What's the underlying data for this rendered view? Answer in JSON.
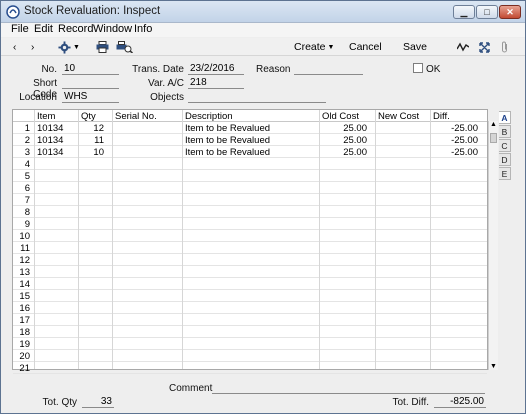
{
  "window": {
    "title": "Stock Revaluation: Inspect"
  },
  "menu": [
    "File",
    "Edit",
    "Record",
    "Window",
    "Info"
  ],
  "toolbar": {
    "create_label": "Create",
    "cancel_label": "Cancel",
    "save_label": "Save"
  },
  "header": {
    "no_label": "No.",
    "no_value": "10",
    "trans_date_label": "Trans. Date",
    "trans_date_value": "23/2/2016",
    "reason_label": "Reason",
    "reason_value": "",
    "ok_label": "OK",
    "short_code_label": "Short Code",
    "short_code_value": "",
    "var_ac_label": "Var. A/C",
    "var_ac_value": "218",
    "location_label": "Location",
    "location_value": "WHS",
    "objects_label": "Objects",
    "objects_value": ""
  },
  "grid": {
    "columns": [
      "Item",
      "Qty",
      "Serial No.",
      "Description",
      "Old Cost",
      "New Cost",
      "Diff."
    ],
    "rows": [
      {
        "n": "1",
        "item": "10134",
        "qty": "12",
        "serial": "",
        "desc": "Item to be Revalued",
        "old": "25.00",
        "new": "",
        "diff": "-25.00"
      },
      {
        "n": "2",
        "item": "10134",
        "qty": "11",
        "serial": "",
        "desc": "Item to be Revalued",
        "old": "25.00",
        "new": "",
        "diff": "-25.00"
      },
      {
        "n": "3",
        "item": "10134",
        "qty": "10",
        "serial": "",
        "desc": "Item to be Revalued",
        "old": "25.00",
        "new": "",
        "diff": "-25.00"
      },
      {
        "n": "4"
      },
      {
        "n": "5"
      },
      {
        "n": "6"
      },
      {
        "n": "7"
      },
      {
        "n": "8"
      },
      {
        "n": "9"
      },
      {
        "n": "10"
      },
      {
        "n": "11"
      },
      {
        "n": "12"
      },
      {
        "n": "13"
      },
      {
        "n": "14"
      },
      {
        "n": "15"
      },
      {
        "n": "16"
      },
      {
        "n": "17"
      },
      {
        "n": "18"
      },
      {
        "n": "19"
      },
      {
        "n": "20"
      },
      {
        "n": "21"
      }
    ],
    "tabs": [
      "A",
      "B",
      "C",
      "D",
      "E"
    ],
    "active_tab": "A"
  },
  "footer": {
    "comment_label": "Comment",
    "comment_value": "",
    "tot_qty_label": "Tot. Qty",
    "tot_qty_value": "33",
    "tot_diff_label": "Tot. Diff.",
    "tot_diff_value": "-825.00"
  },
  "colors": {
    "titlebar": "#c2d3e8",
    "accent": "#1a3f8a"
  },
  "icons": [
    "app-icon",
    "minimize-icon",
    "maximize-icon",
    "close-icon",
    "back-arrow-icon",
    "forward-arrow-icon",
    "gear-icon",
    "print-icon",
    "print-preview-icon",
    "dropdown-arrow-icon",
    "activity-icon",
    "expand-icon",
    "attachment-icon"
  ]
}
